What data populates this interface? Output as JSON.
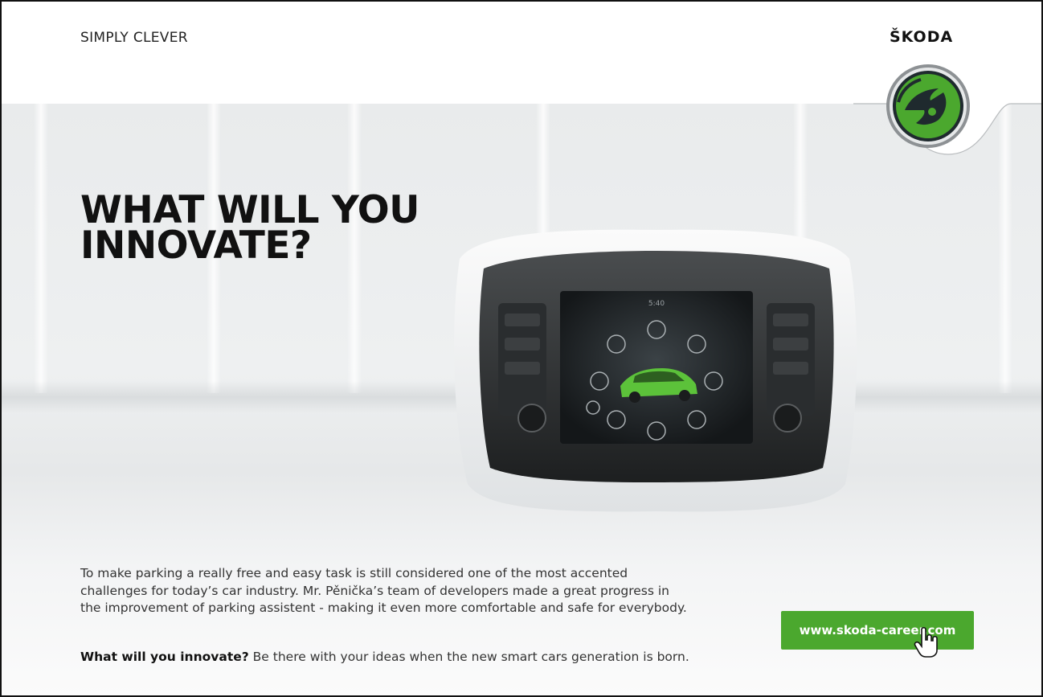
{
  "header": {
    "tagline": "SIMPLY CLEVER",
    "brand": "ŠKODA",
    "logo_icon": "skoda-arrow-logo-icon"
  },
  "headline": {
    "line1": "WHAT WILL YOU",
    "line2": "INNOVATE?"
  },
  "device_screen": {
    "time": "5:40"
  },
  "body": {
    "paragraph": "To make parking a really free and easy task is still considered one of the most accented challenges for today’s car industry. Mr. Pěnička’s team of developers made a great progress in the improvement of parking assistent - making it even more comfortable and safe for everybody.",
    "cta_bold": "What will you innovate?",
    "cta_rest": " Be there with your ideas when the new smart cars generation is born."
  },
  "button": {
    "label": "www.skoda-career.com",
    "cursor_icon": "hand-pointer-icon"
  },
  "colors": {
    "accent_green": "#4ba82e",
    "text_dark": "#111111"
  }
}
